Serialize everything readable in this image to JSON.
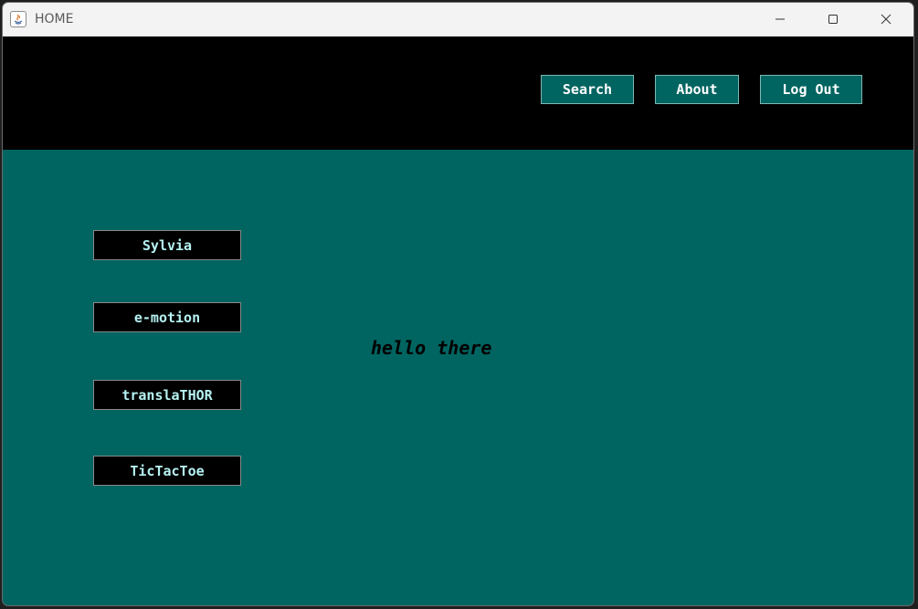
{
  "window": {
    "title": "HOME",
    "controls": {
      "minimize_icon": "minimize-icon",
      "maximize_icon": "maximize-icon",
      "close_icon": "close-icon"
    }
  },
  "header": {
    "buttons": [
      {
        "label": "Search"
      },
      {
        "label": "About"
      },
      {
        "label": "Log Out"
      }
    ]
  },
  "main": {
    "apps": [
      {
        "label": "Sylvia"
      },
      {
        "label": "e-motion"
      },
      {
        "label": "translaTHOR"
      },
      {
        "label": "TicTacToe"
      }
    ],
    "greeting": "hello there"
  },
  "colors": {
    "background_teal": "#006461",
    "header_black": "#000000",
    "app_button_text": "#b6f2f2",
    "nav_button_text": "#ffffff"
  }
}
